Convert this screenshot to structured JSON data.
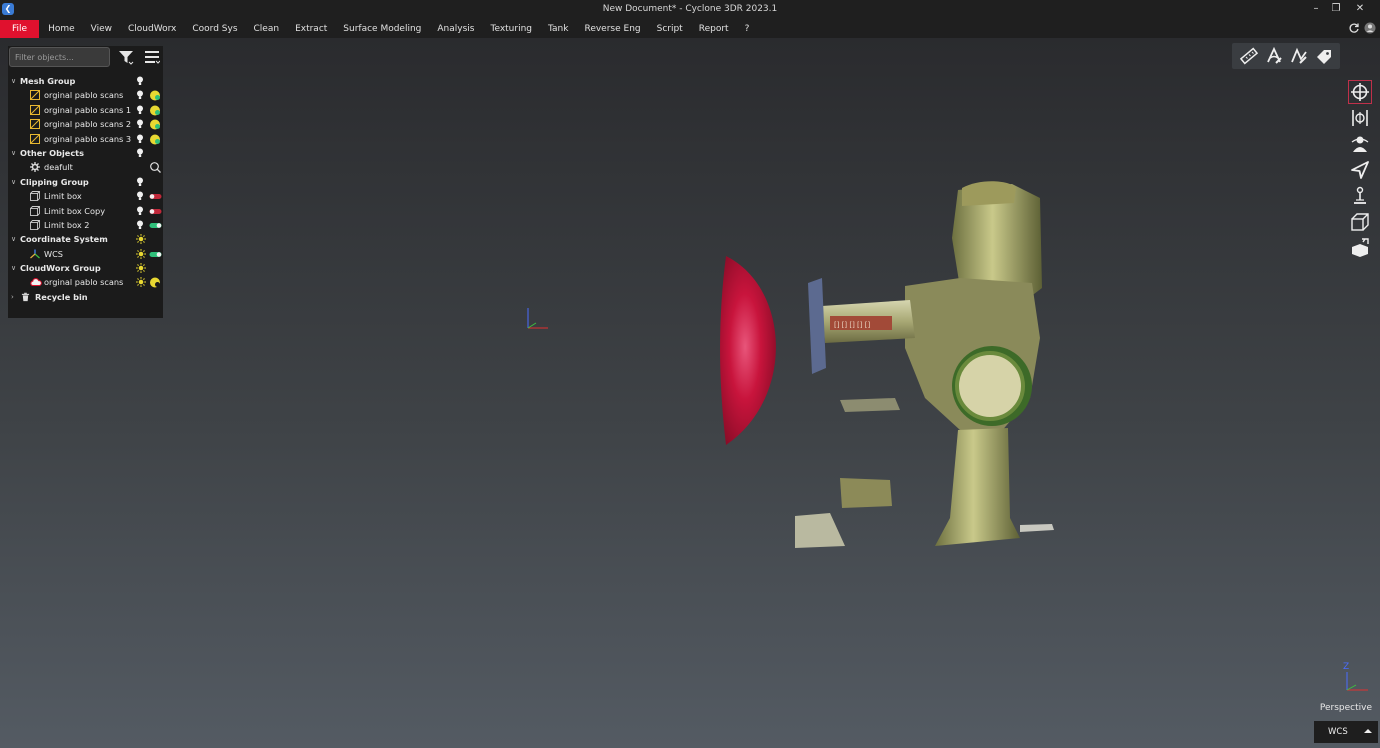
{
  "window": {
    "title": "New Document* - Cyclone 3DR 2023.1",
    "minimize_glyph": "–",
    "restore_glyph": "❐",
    "close_glyph": "✕"
  },
  "menu": {
    "items": [
      "File",
      "Home",
      "View",
      "CloudWorx",
      "Coord Sys",
      "Clean",
      "Extract",
      "Surface Modeling",
      "Analysis",
      "Texturing",
      "Tank",
      "Reverse Eng",
      "Script",
      "Report",
      "?"
    ]
  },
  "tree": {
    "filter_placeholder": "Filter objects...",
    "rows": [
      {
        "kind": "group",
        "label": "Mesh Group",
        "expander": "∨",
        "vis": "bulb"
      },
      {
        "kind": "child",
        "label": "orginal pablo scans",
        "icon": "mesh-icon",
        "vis": "bulb",
        "state": "yellow"
      },
      {
        "kind": "child",
        "label": "orginal pablo scans 1",
        "icon": "mesh-icon",
        "vis": "bulb",
        "state": "yellow"
      },
      {
        "kind": "child",
        "label": "orginal pablo scans 2",
        "icon": "mesh-icon",
        "vis": "bulb",
        "state": "yellow"
      },
      {
        "kind": "child",
        "label": "orginal pablo scans 3",
        "icon": "mesh-icon",
        "vis": "bulb",
        "state": "yellow"
      },
      {
        "kind": "group",
        "label": "Other Objects",
        "expander": "∨",
        "vis": "bulb"
      },
      {
        "kind": "child",
        "label": "deafult",
        "icon": "gear-icon",
        "vis": "none",
        "state": "search"
      },
      {
        "kind": "group",
        "label": "Clipping Group",
        "expander": "∨",
        "vis": "bulb"
      },
      {
        "kind": "child",
        "label": "Limit box",
        "icon": "box-icon",
        "vis": "bulb",
        "state": "toggle-off"
      },
      {
        "kind": "child",
        "label": "Limit box Copy",
        "icon": "box-icon",
        "vis": "bulb",
        "state": "toggle-off"
      },
      {
        "kind": "child",
        "label": "Limit box 2",
        "icon": "box-icon",
        "vis": "bulb",
        "state": "toggle-on"
      },
      {
        "kind": "group",
        "label": "Coordinate System",
        "expander": "∨",
        "vis": "sun"
      },
      {
        "kind": "child",
        "label": "WCS",
        "icon": "axes-icon",
        "vis": "sun",
        "state": "toggle-on"
      },
      {
        "kind": "group",
        "label": "CloudWorx Group",
        "expander": "∨",
        "vis": "sun"
      },
      {
        "kind": "child",
        "label": "orginal pablo scans",
        "icon": "cloud-icon",
        "vis": "sun",
        "state": "yellow"
      },
      {
        "kind": "group",
        "label": "Recycle bin",
        "expander": "›",
        "vis": "none",
        "icon": "trash-icon"
      }
    ]
  },
  "viewport": {
    "projection_label": "Perspective",
    "coord_system": "WCS",
    "axis_label": "Z"
  },
  "colors": {
    "accent": "#e0112e",
    "sphere": "#c8143c",
    "toggle_on": "#2fbf7a",
    "toggle_off": "#c0283a",
    "state_yellow": "#e8d832"
  }
}
